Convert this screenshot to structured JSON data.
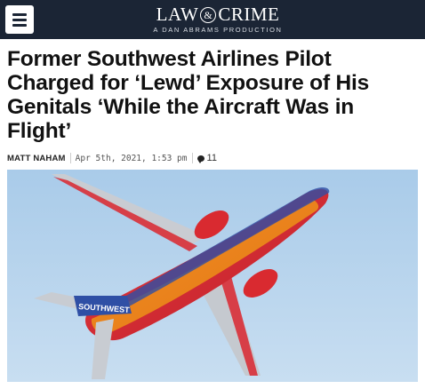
{
  "header": {
    "logo_left": "LAW",
    "logo_amp": "&",
    "logo_right": "CRIME",
    "logo_tagline": "A DAN ABRAMS PRODUCTION",
    "menu_icon": "hamburger-menu-icon",
    "background_color": "#1b2535"
  },
  "article": {
    "headline": "Former Southwest Airlines Pilot Charged for ‘Lewd’ Exposure of His Genitals ‘While the Aircraft Was in Flight’",
    "author": "MATT NAHAM",
    "date": "Apr 5th, 2021, 1:53 pm",
    "comment_icon": "comment-bubble-icon",
    "comment_count": "11"
  },
  "hero_image": {
    "subject": "Southwest Airlines jet in flight",
    "livery_text": "SOUTHWEST",
    "sky_color": "#b9d6ef",
    "fuselage_color": "#d9232f",
    "belly_color": "#f2a014",
    "tail_color": "#2f4fa5"
  }
}
